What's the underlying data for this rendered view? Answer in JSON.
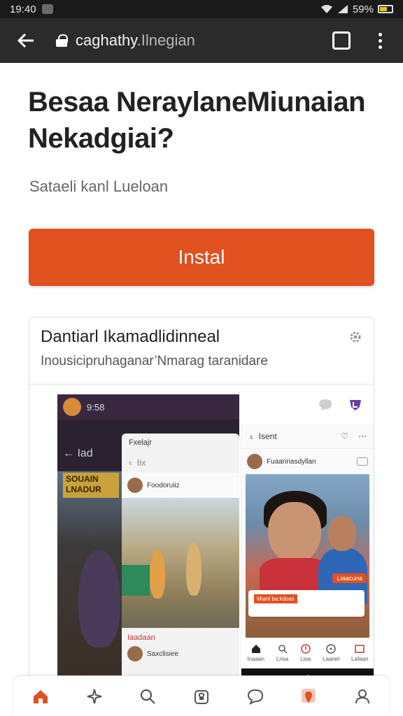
{
  "status_bar": {
    "time": "19:40",
    "battery": "59%"
  },
  "browser": {
    "url_main": "caghathy",
    "url_rest": ".Ilnegian",
    "tab_count": ""
  },
  "page": {
    "title": "Besaa NeraylaneMiunaian Nekadgiai?",
    "subtitle": "Sataeli kanl Lueloan",
    "install_label": "Instal"
  },
  "card": {
    "title": "Dantiarl Ikamadlidinneal",
    "subtitle": "Inousicipruhaganar’Nmarag taranidare",
    "left_phone": {
      "status_text": "9:58",
      "nav_text": "Iad",
      "sign_text": "SOUAIN\nLNADUR"
    },
    "overlay": {
      "header": "Fxelajr",
      "nav": "Iix",
      "post_author": "Foodoruiiz",
      "label": "Iaadaan",
      "row": "Saxclisiee"
    },
    "right_phone": {
      "header": "Isent",
      "post_author": "Fuaarinasdyllan",
      "tag": "Liaacuna",
      "comment_chip": "Mianl ba:kdoas",
      "tabs": [
        "Inaaan",
        "Lrisa",
        "Lioa",
        "Laanel",
        "Lafaan"
      ]
    }
  },
  "colors": {
    "accent": "#e1501f",
    "browser_bar": "#2b2b2b",
    "status_bar": "#1a1a1a"
  },
  "bottom_nav": [
    "home-icon",
    "sparkle-icon",
    "search-icon",
    "lock-icon",
    "chat-icon",
    "map-pin-icon",
    "profile-icon"
  ]
}
